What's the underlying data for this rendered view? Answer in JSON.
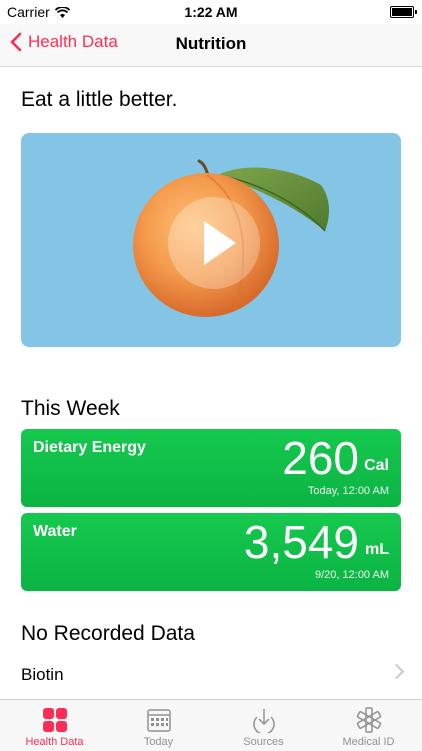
{
  "status": {
    "carrier": "Carrier",
    "time": "1:22 AM"
  },
  "nav": {
    "back_label": "Health Data",
    "title": "Nutrition"
  },
  "headline": "Eat a little better.",
  "week": {
    "heading": "This Week",
    "cards": [
      {
        "label": "Dietary Energy",
        "value": "260",
        "unit": "Cal",
        "stamp": "Today, 12:00 AM"
      },
      {
        "label": "Water",
        "value": "3,549",
        "unit": "mL",
        "stamp": "9/20, 12:00 AM"
      }
    ]
  },
  "no_data": {
    "heading": "No Recorded Data",
    "items": [
      {
        "label": "Biotin"
      }
    ]
  },
  "tabs": [
    {
      "label": "Health Data",
      "icon": "health-data-icon",
      "active": true
    },
    {
      "label": "Today",
      "icon": "calendar-icon",
      "active": false
    },
    {
      "label": "Sources",
      "icon": "sources-download-icon",
      "active": false
    },
    {
      "label": "Medical ID",
      "icon": "medical-id-icon",
      "active": false
    }
  ],
  "colors": {
    "accent": "#ff2d55",
    "card": "#12c04a",
    "video_bg": "#84c5e6"
  }
}
